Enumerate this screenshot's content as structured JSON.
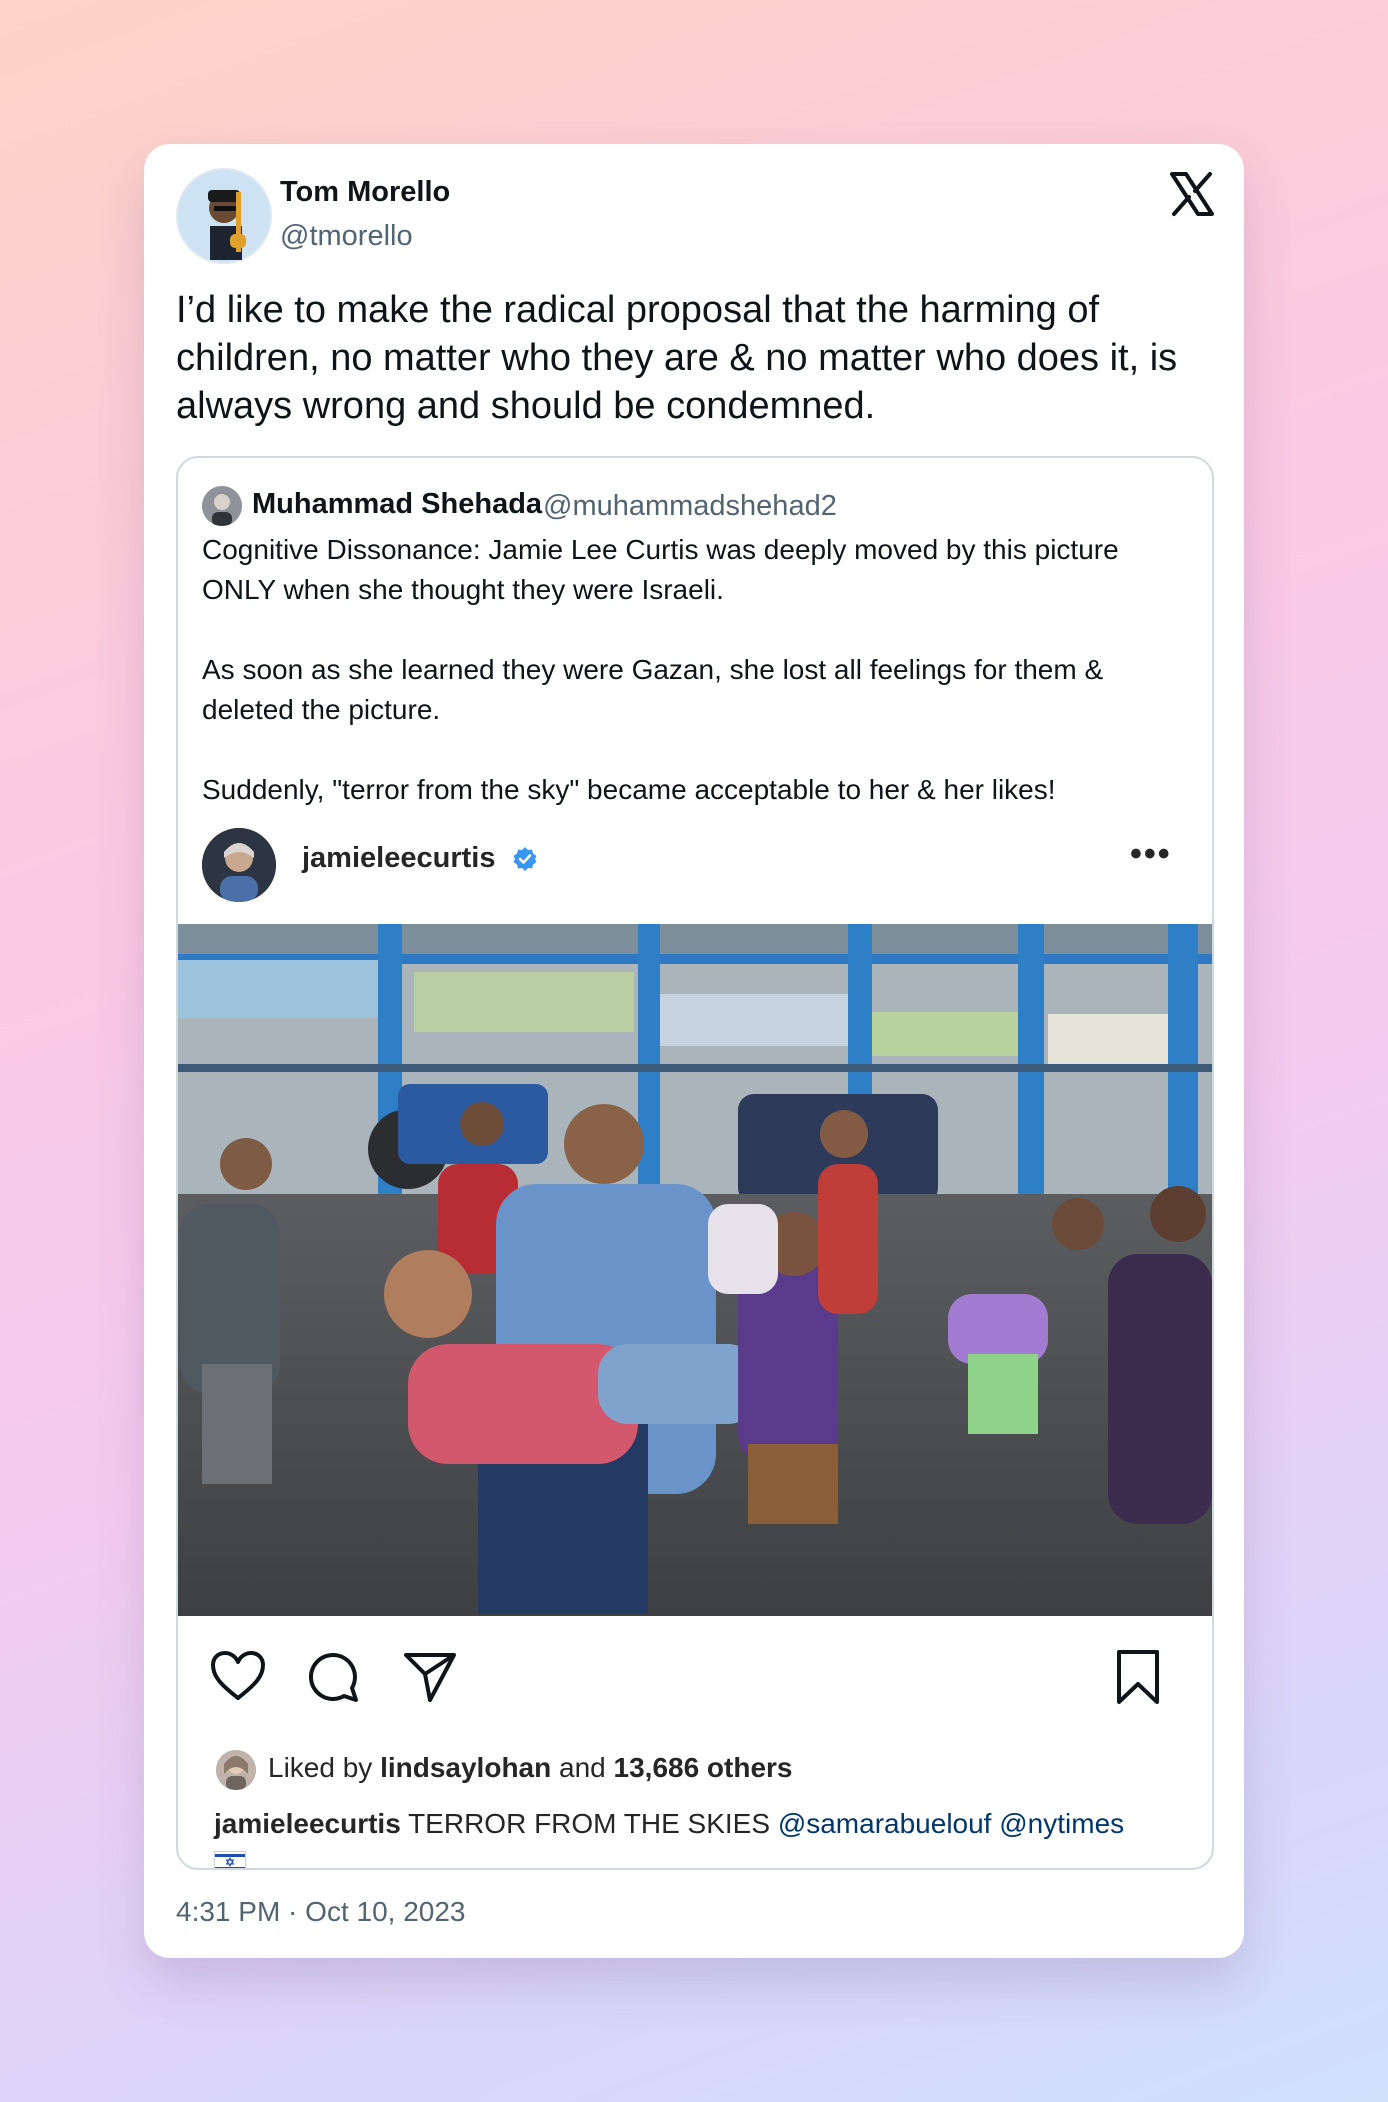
{
  "tweet": {
    "author_name": "Tom Morello",
    "author_handle": "@tmorello",
    "text": "I’d like to make the radical proposal that the harming of children, no matter who they are & no matter who does it, is always wrong and should be condemned.",
    "timestamp": "4:31 PM · Oct 10, 2023",
    "platform_icon": "x-logo-icon"
  },
  "quoted_tweet": {
    "author_name": "Muhammad Shehada",
    "author_handle": "@muhammadshehad2",
    "paragraphs": [
      "Cognitive Dissonance: Jamie Lee Curtis was deeply moved by this picture ONLY when she thought they were Israeli.",
      "As soon as she learned they were Gazan, she lost all feelings for them & deleted the picture.",
      "Suddenly,  \"terror from the sky\" became acceptable to her & her likes!"
    ]
  },
  "instagram_post": {
    "username": "jamieleecurtis",
    "verified_icon": "verified-badge-icon",
    "more_label": "•••",
    "liked_prefix": "Liked by",
    "liked_user": "lindsaylohan",
    "liked_and": "and",
    "liked_count": "13,686 others",
    "caption_user": "jamieleecurtis",
    "caption_text": "TERROR FROM THE SKIES",
    "mention_1": "@samarabuelouf",
    "mention_2": "@nytimes",
    "flag_icon": "israel-flag-icon",
    "action_icons": [
      "heart-icon",
      "comment-icon",
      "share-icon",
      "bookmark-icon"
    ]
  },
  "colors": {
    "text": "#0f1419",
    "secondary": "#536471",
    "border": "#cfd9de",
    "mention": "#00376b",
    "verified": "#3897f0"
  }
}
